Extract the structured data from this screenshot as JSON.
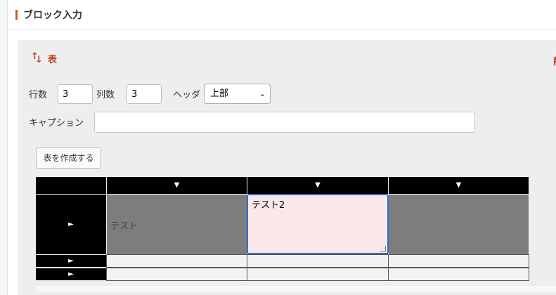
{
  "header": {
    "title": "ブロック入力"
  },
  "block": {
    "type_icon": "sort-arrows-icon",
    "type_label": "表",
    "cut_char": "削"
  },
  "form": {
    "rows_label": "行数",
    "rows_value": "3",
    "cols_label": "列数",
    "cols_value": "3",
    "header_label": "ヘッダ",
    "header_selected": "上部",
    "caption_label": "キャプション",
    "caption_value": "",
    "create_button": "表を作成する"
  },
  "table": {
    "col_markers": [
      "▼",
      "▼",
      "▼"
    ],
    "row_markers": [
      "►",
      "►",
      "►"
    ],
    "cells": [
      [
        "テスト",
        "テスト2",
        ""
      ],
      [
        "",
        "",
        ""
      ],
      [
        "",
        "",
        ""
      ]
    ]
  },
  "colors": {
    "accent": "#d9522a",
    "focus": "#2f6fd6",
    "editor_bg": "#fae8e8"
  }
}
